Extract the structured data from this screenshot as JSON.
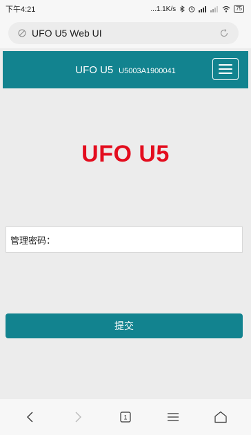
{
  "status_bar": {
    "time": "下午4:21",
    "network_speed": "...1.1K/s",
    "battery": "75"
  },
  "browser": {
    "url_title": "UFO U5 Web UI",
    "tab_count": "1"
  },
  "header": {
    "brand": "UFO U5",
    "serial": "U5003A1900041"
  },
  "main": {
    "title": "UFO U5",
    "password_label": "管理密码：",
    "password_value": "",
    "submit_label": "提交"
  },
  "colors": {
    "brand_teal": "#12838f",
    "title_red": "#e30d1e"
  },
  "icons": [
    "back-icon",
    "forward-icon",
    "tabs-icon",
    "menu-icon",
    "home-icon",
    "reload-icon",
    "hamburger-icon"
  ]
}
